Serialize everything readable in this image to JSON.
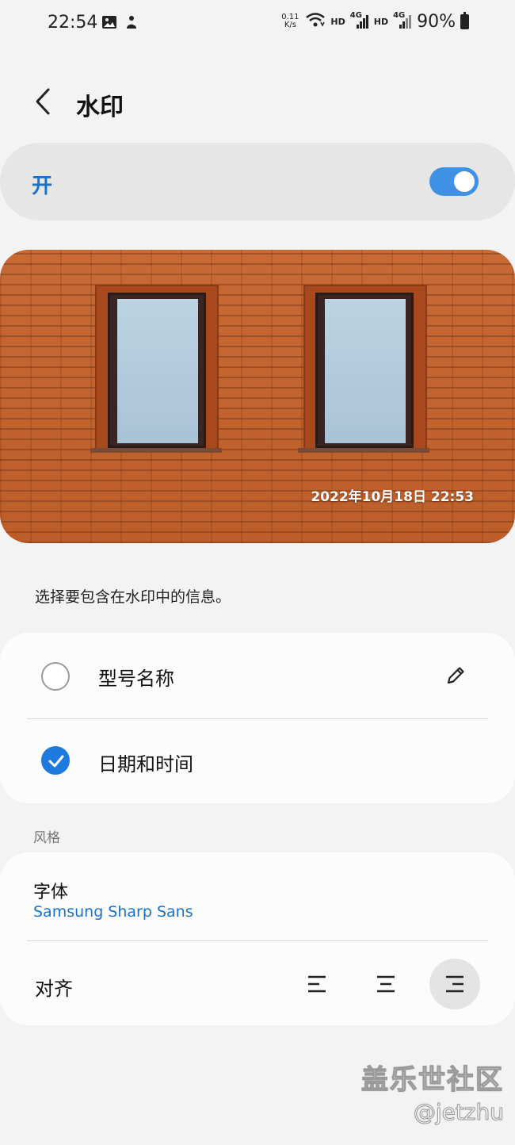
{
  "status_bar": {
    "time": "22:54",
    "net_speed_value": "0.11",
    "net_speed_unit": "K/s",
    "hd1": "HD",
    "net1": "4G",
    "hd2": "HD",
    "net2": "4G",
    "battery": "90%",
    "icons": [
      "image-icon",
      "notification-app-icon",
      "wifi-icon",
      "signal-icon",
      "battery-icon"
    ]
  },
  "header": {
    "title": "水印",
    "back_icon": "chevron-left-icon"
  },
  "master_switch": {
    "label": "开",
    "state": "on",
    "accent": "#3e91e4"
  },
  "preview": {
    "watermark_text": "2022年10月18日 22:53"
  },
  "description": "选择要包含在水印中的信息。",
  "info_options": [
    {
      "label": "型号名称",
      "checked": false,
      "edit_icon": "pencil-icon"
    },
    {
      "label": "日期和时间",
      "checked": true
    }
  ],
  "style_section": {
    "label": "风格",
    "font_title": "字体",
    "font_value": "Samsung Sharp Sans",
    "align_label": "对齐",
    "align_options": [
      "align-left-icon",
      "align-center-icon",
      "align-right-icon"
    ],
    "align_selected": "right"
  },
  "overlay": {
    "site": "盖乐世社区",
    "author": "@jetzhu"
  }
}
